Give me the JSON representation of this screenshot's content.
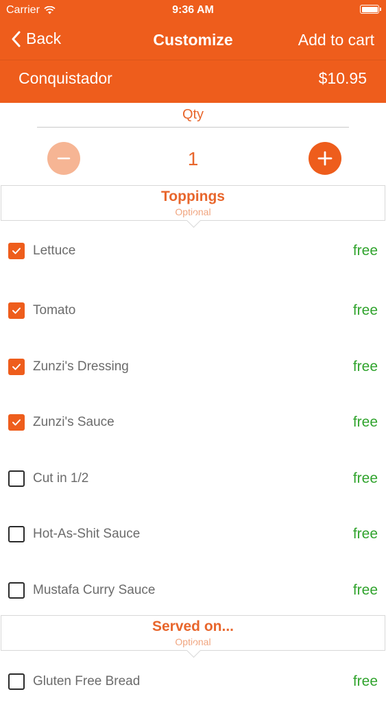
{
  "status_bar": {
    "carrier": "Carrier",
    "time": "9:36 AM"
  },
  "nav": {
    "back_label": "Back",
    "title": "Customize",
    "add_to_cart_label": "Add to cart"
  },
  "item": {
    "name": "Conquistador",
    "price": "$10.95"
  },
  "qty": {
    "label": "Qty",
    "value": "1"
  },
  "sections": [
    {
      "title": "Toppings",
      "subtitle": "Optional",
      "items": [
        {
          "label": "Lettuce",
          "price": "free",
          "checked": true
        },
        {
          "label": "Tomato",
          "price": "free",
          "checked": true
        },
        {
          "label": "Zunzi's Dressing",
          "price": "free",
          "checked": true
        },
        {
          "label": "Zunzi's Sauce",
          "price": "free",
          "checked": true
        },
        {
          "label": "Cut in 1/2",
          "price": "free",
          "checked": false
        },
        {
          "label": "Hot-As-Shit Sauce",
          "price": "free",
          "checked": false
        },
        {
          "label": "Mustafa Curry Sauce",
          "price": "free",
          "checked": false
        }
      ]
    },
    {
      "title": "Served on...",
      "subtitle": "Optional",
      "items": [
        {
          "label": "Gluten Free Bread",
          "price": "free",
          "checked": false
        }
      ]
    }
  ],
  "colors": {
    "brand": "#ee5d1c",
    "price_free": "#2fa32c",
    "label": "#6b6b6b"
  },
  "icons": [
    "wifi-icon",
    "battery-icon",
    "chevron-left-icon",
    "minus-icon",
    "plus-icon",
    "checkmark-icon"
  ]
}
